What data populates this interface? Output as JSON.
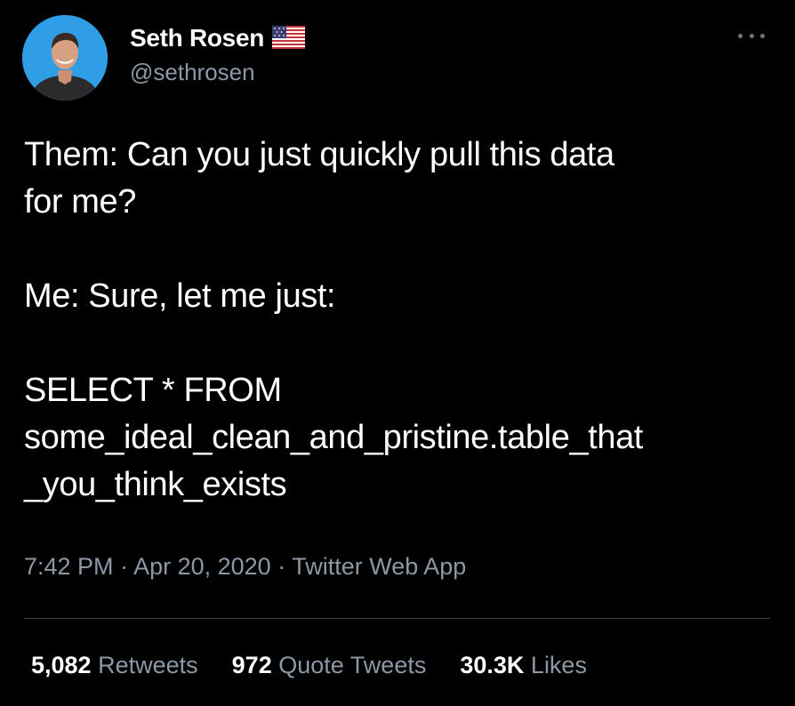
{
  "author": {
    "display_name": "Seth Rosen",
    "handle": "@sethrosen",
    "flag_icon": "us-flag-icon"
  },
  "tweet": {
    "line1": "Them: Can you just quickly pull this data",
    "line2": "for me?",
    "line3": "Me: Sure, let me just:",
    "line4": "SELECT * FROM",
    "line5": "some_ideal_clean_and_pristine.table_that",
    "line6": "_you_think_exists"
  },
  "meta": {
    "time": "7:42 PM",
    "sep1": " · ",
    "date": "Apr 20, 2020",
    "sep2": " · ",
    "source": "Twitter Web App"
  },
  "stats": {
    "retweets_count": "5,082",
    "retweets_label": "Retweets",
    "quotes_count": "972",
    "quotes_label": "Quote Tweets",
    "likes_count": "30.3K",
    "likes_label": "Likes"
  },
  "colors": {
    "background": "#000000",
    "text_primary": "#ffffff",
    "text_secondary": "#8b98a5",
    "divider": "#38444d",
    "avatar_bg": "#2f9ee6"
  }
}
